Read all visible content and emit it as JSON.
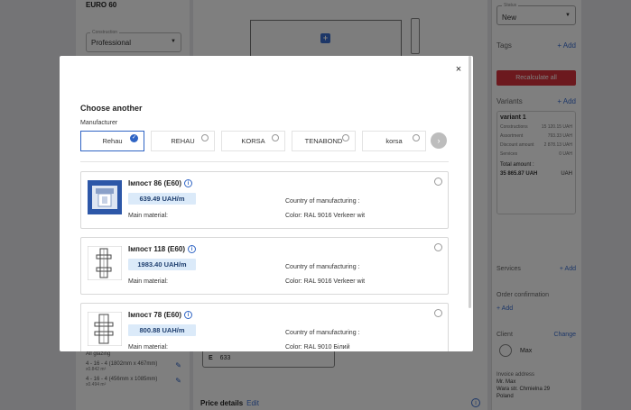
{
  "background": {
    "left_panel": {
      "profile_title": "EURO 60",
      "construction_label": "Construction",
      "construction_value": "Professional",
      "glazing_title": "All glazing",
      "glazing_items": [
        {
          "text": "4 - 16 - 4 (1802mm x 467mm)",
          "sub": "x0.842 m²"
        },
        {
          "text": "4 - 16 - 4 (456mm x 1085mm)",
          "sub": "x0.494 m²"
        }
      ]
    },
    "center": {
      "field_value": "633",
      "field_prefix": "E",
      "price_details_label": "Price details",
      "edit_label": "Edit"
    },
    "right_panel": {
      "status_label": "Status",
      "status_value": "New",
      "tags_label": "Tags",
      "add_label": "+ Add",
      "recalculate_label": "Recalculate all",
      "variants_label": "Variants",
      "variant": {
        "title": "variant 1",
        "rows": [
          {
            "k": "Constructions",
            "v": "15 120.15 UAH"
          },
          {
            "k": "Assortment",
            "v": "793.33 UAH"
          },
          {
            "k": "Discount amount",
            "v": "2 878.13 UAH"
          },
          {
            "k": "Services",
            "v": "0 UAH"
          }
        ],
        "total_label": "Total amount :",
        "total_value": "35 865.87 UAH",
        "currency": "UAH"
      },
      "services_row_label": "Services",
      "order_confirmation_label": "Order confirmation",
      "client_label": "Client",
      "change_label": "Change",
      "client_name": "Max",
      "invoice_address_label": "Invoice address",
      "address_lines": [
        "Mr. Max",
        "Wara str. Chmielna 29",
        "Poland"
      ]
    }
  },
  "modal": {
    "title": "Choose another",
    "manufacturer_label": "Manufacturer",
    "manufacturers": [
      {
        "name": "Rehau",
        "selected": true
      },
      {
        "name": "REHAU",
        "selected": false
      },
      {
        "name": "KORSA",
        "selected": false
      },
      {
        "name": "TENABOND",
        "selected": false
      },
      {
        "name": "korsa",
        "selected": false
      }
    ],
    "next_arrow": "›",
    "close_glyph": "×",
    "info_glyph": "i",
    "check_glyph": "✓",
    "main_material_label": "Main material:",
    "country_label": "Country of manufacturing :",
    "products": [
      {
        "name": "Імпост 86 (E60)",
        "price": "639.49 UAH/m",
        "color": "Color: RAL 9016 Verkeer wit"
      },
      {
        "name": "Імпост 118 (E60)",
        "price": "1983.40 UAH/m",
        "color": "Color: RAL 9016 Verkeer wit"
      },
      {
        "name": "Імпост 78 (E60)",
        "price": "800.88 UAH/m",
        "color": "Color: RAL 9010 Білий"
      }
    ]
  },
  "colors": {
    "accent": "#2f64c4",
    "danger": "#d9333c",
    "price_bg": "#dbeaf9"
  }
}
